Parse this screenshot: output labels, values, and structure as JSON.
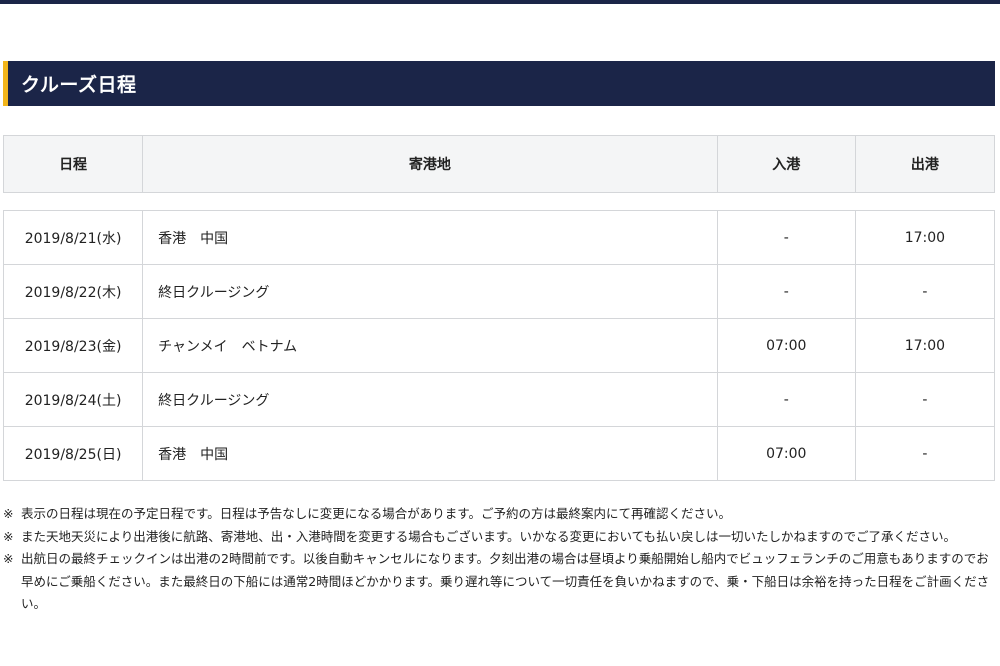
{
  "section": {
    "title": "クルーズ日程"
  },
  "table": {
    "headers": {
      "date": "日程",
      "port": "寄港地",
      "arrival": "入港",
      "departure": "出港"
    },
    "rows": [
      {
        "date": "2019/8/21(水)",
        "port": "香港　中国",
        "arrival": "-",
        "departure": "17:00"
      },
      {
        "date": "2019/8/22(木)",
        "port": "終日クルージング",
        "arrival": "-",
        "departure": "-"
      },
      {
        "date": "2019/8/23(金)",
        "port": "チャンメイ　ベトナム",
        "arrival": "07:00",
        "departure": "17:00"
      },
      {
        "date": "2019/8/24(土)",
        "port": "終日クルージング",
        "arrival": "-",
        "departure": "-"
      },
      {
        "date": "2019/8/25(日)",
        "port": "香港　中国",
        "arrival": "07:00",
        "departure": "-"
      }
    ]
  },
  "notes": {
    "mark": "※",
    "items": [
      "表示の日程は現在の予定日程です。日程は予告なしに変更になる場合があります。ご予約の方は最終案内にて再確認ください。",
      "また天地天災により出港後に航路、寄港地、出・入港時間を変更する場合もございます。いかなる変更においても払い戻しは一切いたしかねますのでご了承ください。",
      "出航日の最終チェックインは出港の2時間前です。以後自動キャンセルになります。夕刻出港の場合は昼頃より乗船開始し船内でビュッフェランチのご用意もありますのでお早めにご乗船ください。また最終日の下船には通常2時間ほどかかります。乗り遅れ等について一切責任を負いかねますので、乗・下船日は余裕を持った日程をご計画ください。"
    ]
  }
}
